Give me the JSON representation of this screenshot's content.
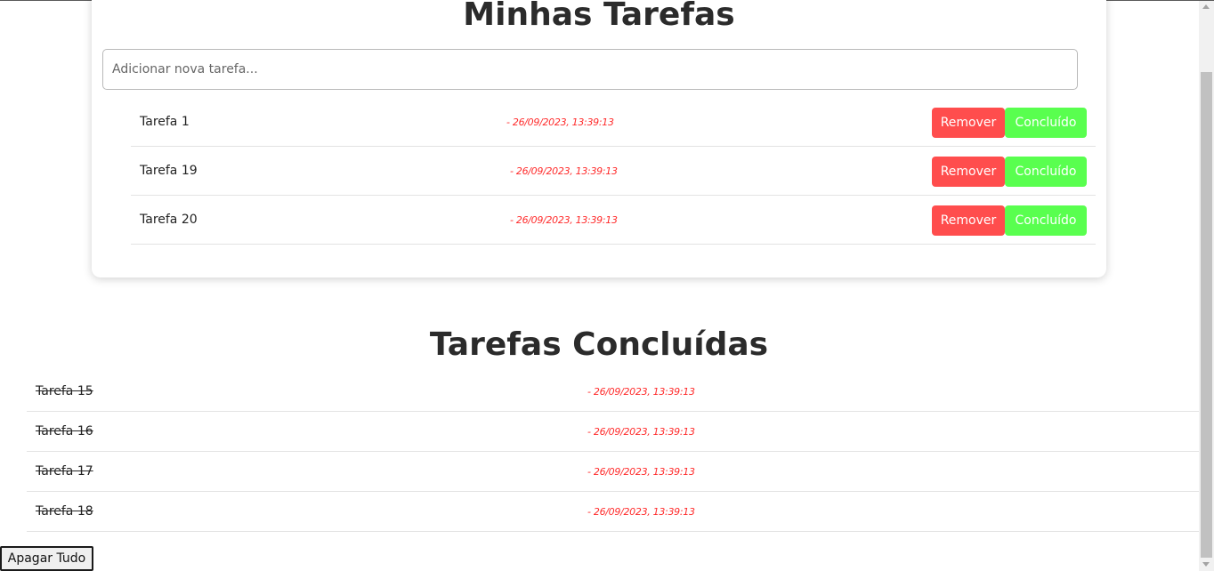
{
  "colors": {
    "remove_button": "#ff4d4d",
    "done_button": "#59ff4f",
    "date_text": "#ff2b2b"
  },
  "pending": {
    "title": "Minhas Tarefas",
    "input_placeholder": "Adicionar nova tarefa...",
    "tasks": [
      {
        "name": "Tarefa 1",
        "date": "- 26/09/2023, 13:39:13",
        "remove_label": "Remover",
        "done_label": "Concluído"
      },
      {
        "name": "Tarefa 19",
        "date": "- 26/09/2023, 13:39:13",
        "remove_label": "Remover",
        "done_label": "Concluído"
      },
      {
        "name": "Tarefa 20",
        "date": "- 26/09/2023, 13:39:13",
        "remove_label": "Remover",
        "done_label": "Concluído"
      }
    ]
  },
  "completed": {
    "title": "Tarefas Concluídas",
    "tasks": [
      {
        "name": "Tarefa 15",
        "date": "- 26/09/2023, 13:39:13"
      },
      {
        "name": "Tarefa 16",
        "date": "- 26/09/2023, 13:39:13"
      },
      {
        "name": "Tarefa 17",
        "date": "- 26/09/2023, 13:39:13"
      },
      {
        "name": "Tarefa 18",
        "date": "- 26/09/2023, 13:39:13"
      }
    ]
  },
  "clear_all_label": "Apagar Tudo"
}
